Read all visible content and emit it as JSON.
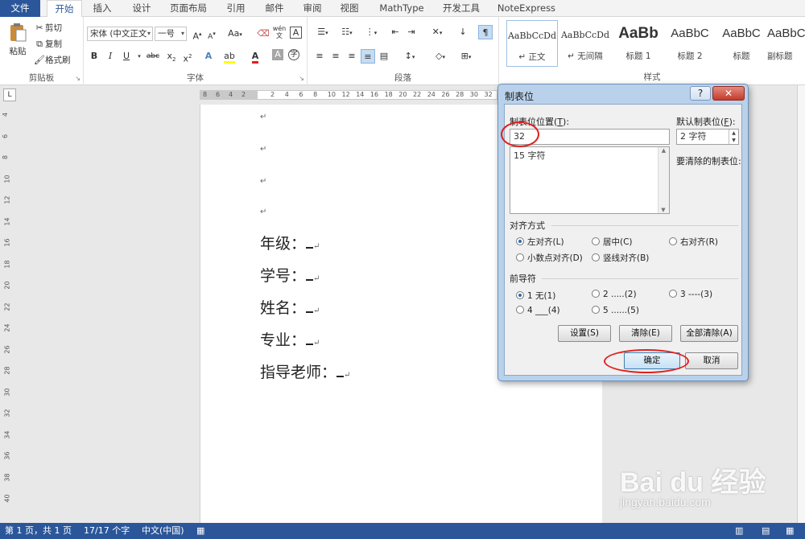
{
  "tabs": [
    "文件",
    "开始",
    "插入",
    "设计",
    "页面布局",
    "引用",
    "邮件",
    "审阅",
    "视图",
    "MathType",
    "开发工具",
    "NoteExpress"
  ],
  "ribbon": {
    "clipboard": {
      "paste": "粘贴",
      "cut": "剪切",
      "copy": "复制",
      "format_painter": "格式刷",
      "label": "剪贴板"
    },
    "font": {
      "name": "宋体 (中文正文",
      "size": "一号",
      "label": "字体",
      "change_case": "Aa",
      "phonetic_guide": "wén"
    },
    "paragraph": {
      "label": "段落"
    },
    "styles": {
      "label": "样式",
      "items": [
        {
          "sample": "AaBbCcDd",
          "name": "↵ 正文"
        },
        {
          "sample": "AaBbCcDd",
          "name": "↵ 无间隔"
        },
        {
          "sample": "AaBb",
          "name": "标题 1"
        },
        {
          "sample": "AaBbC",
          "name": "标题 2"
        },
        {
          "sample": "AaBbC",
          "name": "标题"
        },
        {
          "sample": "AaBbC",
          "name": "副标题"
        }
      ]
    }
  },
  "ruler": {
    "numbers": [
      "8",
      "6",
      "4",
      "2",
      "2",
      "4",
      "6",
      "8",
      "10",
      "12",
      "14",
      "16",
      "18",
      "20",
      "22",
      "24",
      "26",
      "28",
      "30",
      "32"
    ],
    "vnumbers": [
      "4",
      "6",
      "8",
      "10",
      "12",
      "14",
      "16",
      "18",
      "20",
      "22",
      "24",
      "26",
      "28",
      "30",
      "32",
      "34",
      "36",
      "38",
      "40"
    ]
  },
  "document": {
    "para_mark": "↵",
    "lines": [
      {
        "text": "年级：",
        "mark": "↵"
      },
      {
        "text": "学号：",
        "mark": "↵"
      },
      {
        "text": "姓名：",
        "mark": "↵"
      },
      {
        "text": "专业：",
        "mark": "↵"
      },
      {
        "text": "指导老师：",
        "mark": "↵"
      }
    ]
  },
  "dialog": {
    "title": "制表位",
    "help": "?",
    "close": "✕",
    "tab_position_label": "制表位位置(",
    "tab_position_key": "T",
    "tab_position_value": "32",
    "tab_list": [
      "15 字符"
    ],
    "default_tab_label": "默认制表位(",
    "default_tab_key": "F",
    "default_tab_value": "2 字符",
    "to_clear_label": "要清除的制表位:",
    "alignment": {
      "title": "对齐方式",
      "options": [
        "左对齐(L)",
        "居中(C)",
        "右对齐(R)",
        "小数点对齐(D)",
        "竖线对齐(B)"
      ],
      "selected": 0
    },
    "leader": {
      "title": "前导符",
      "options": [
        "1 无(1)",
        "2 .....(2)",
        "3 ----(3)",
        "4 ___(4)",
        "5 ......(5)"
      ],
      "selected": 0
    },
    "buttons": {
      "set": "设置(S)",
      "clear": "清除(E)",
      "clear_all": "全部清除(A)",
      "ok": "确定",
      "cancel": "取消"
    }
  },
  "status": {
    "page": "第 1 页，共 1 页",
    "words": "17/17 个字",
    "language": "中文(中国)"
  },
  "watermark": {
    "brand": "Bai du 经验",
    "url": "jingyan.baidu.com"
  }
}
